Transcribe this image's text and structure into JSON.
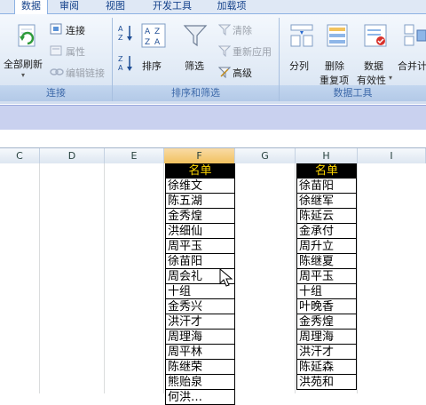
{
  "tabs": [
    "数据",
    "审阅",
    "视图",
    "开发工具",
    "加载项"
  ],
  "groups": {
    "connect": {
      "label": "连接",
      "refresh_all": "全部刷新",
      "connections": "连接",
      "properties": "属性",
      "edit_links": "编辑链接"
    },
    "sort_filter": {
      "label": "排序和筛选",
      "sort": "排序",
      "filter": "筛选",
      "clear": "清除",
      "reapply": "重新应用",
      "advanced": "高级"
    },
    "data_tools": {
      "label": "数据工具",
      "text_to_columns": "分列",
      "remove_dup_line1": "删除",
      "remove_dup_line2": "重复项",
      "validation_line1": "数据",
      "validation_line2": "有效性",
      "consolidate": "合并计"
    }
  },
  "columns": [
    "C",
    "D",
    "E",
    "F",
    "G",
    "H",
    "I"
  ],
  "list_f": {
    "header": "名单",
    "items": [
      "徐维文",
      "陈五湖",
      "金秀煌",
      "洪细仙",
      "周平玉",
      "徐苗阳",
      "周会礼",
      "十组",
      "金秀兴",
      "洪汗才",
      "周理海",
      "周平林",
      "陈继荣",
      "熊贻泉",
      "何洪…"
    ]
  },
  "list_h": {
    "header": "名单",
    "items": [
      "徐苗阳",
      "徐继军",
      "陈延云",
      "金承付",
      "周升立",
      "陈继夏",
      "周平玉",
      "十组",
      "叶晚香",
      "金秀煌",
      "周理海",
      "洪汗才",
      "陈延森",
      "洪苑和"
    ]
  },
  "colors": {
    "header_bg": "#000000",
    "header_text": "#ffd700",
    "selected_col": "#f1c15f",
    "ribbon_bg": "#dfe9f5"
  }
}
